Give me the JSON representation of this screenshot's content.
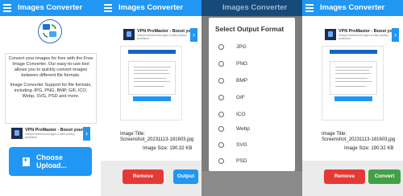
{
  "app": {
    "title": "Images Converter"
  },
  "colors": {
    "primary": "#2196f3",
    "remove": "#e53935",
    "convert": "#43a047"
  },
  "ad": {
    "title": "VPN ProMaster - Boost your...",
    "title_short": "VPN ProMaster - Boost you",
    "subtitle": "Hotspot shield boost apps & sites privacy protection",
    "arrow": "›",
    "tag": "ProMaster"
  },
  "home": {
    "intro_text": "Convert your images for free with the Free Image Converter. Our easy-to-use tool allows you to quickly convert images between different file formats.",
    "formats_text": "Image Converter Support for file formats, including JPG, PNG, BMP, GIF, ICO, Webp, SVG, PSD and more.",
    "choose_button": "Choose Upload..."
  },
  "file": {
    "title_label": "Image Title:",
    "title_value": "Screenshot_20231113-181603.jpg",
    "size_text": "Image Size: 190.32 KB"
  },
  "actions": {
    "remove": "Remove",
    "output": "Output",
    "convert": "Convert"
  },
  "dialog": {
    "title": "Select Output Format",
    "options": [
      "JPG",
      "PNG",
      "BMP",
      "GIF",
      "ICO",
      "Webp",
      "SVG",
      "PSD"
    ]
  },
  "icons": {
    "menu": "hamburger-menu-icon",
    "logo": "image-convert-logo-icon",
    "upload": "file-upload-icon"
  }
}
